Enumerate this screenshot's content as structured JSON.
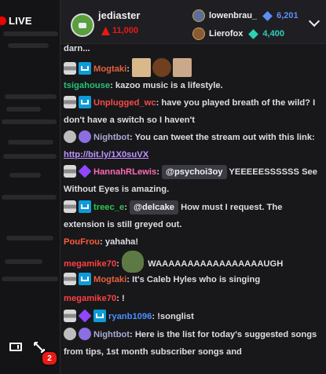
{
  "stream": {
    "live_label": "LIVE",
    "notification_count": "2"
  },
  "header": {
    "host_name": "jediaster",
    "host_bits": "11,000",
    "leaderboard": [
      {
        "name": "lowenbrau_",
        "amount": "6,201",
        "gem_color": "#5d8ef7"
      },
      {
        "name": "Lierofox",
        "amount": "4,400",
        "gem_color": "#2cd1b6"
      }
    ]
  },
  "messages": [
    {
      "badges": [],
      "user": "",
      "text": "darn...",
      "color": "#dedee3"
    },
    {
      "badges": [
        "drum-badge",
        "prime-badge"
      ],
      "user": "Mogtaki",
      "text": "",
      "color": "#e3623b",
      "emotes": 3
    },
    {
      "badges": [],
      "user": "tsigahouse",
      "text": "kazoo music is a lifestyle.",
      "color": "#23c477"
    },
    {
      "badges": [
        "drum-badge",
        "prime-badge"
      ],
      "user": "Unplugged_wc",
      "text": "have you played breath of the wild? I don't have a switch so I haven't",
      "color": "#f84a4a"
    },
    {
      "badges": [
        "bot-badge",
        "verified-badge"
      ],
      "user": "Nightbot",
      "text": "You can tweet the stream out with this link:",
      "link": "http://bit.ly/1X0suVX",
      "color": "#a9a9d4"
    },
    {
      "badges": [
        "drum-badge",
        "gift-badge"
      ],
      "user": "HannahRLewis",
      "mention": "@psychoi3oy",
      "text": "YEEEEESSSSSS See Without Eyes is amazing.",
      "color": "#ff69b4"
    },
    {
      "badges": [
        "drum-badge",
        "prime-badge"
      ],
      "user": "treec_e",
      "mention": "@delcake",
      "text": "How must I request. The extension is still greyed out.",
      "color": "#2ec44f"
    },
    {
      "badges": [],
      "user": "PouFrou",
      "text": "yahaha!",
      "color": "#ff5a3a"
    },
    {
      "badges": [],
      "user": "megamike70",
      "text": "WAAAAAAAAAAAAAAAAAUGH",
      "color": "#ff4040",
      "emotes": 1
    },
    {
      "badges": [
        "drum-badge",
        "prime-badge"
      ],
      "user": "Mogtaki",
      "text": "It's Caleb Hyles who is singing",
      "color": "#e3623b"
    },
    {
      "badges": [],
      "user": "megamike70",
      "text": "!",
      "color": "#ff4040"
    },
    {
      "badges": [
        "drum-badge",
        "gift-badge",
        "prime-badge"
      ],
      "user": "ryanb1096",
      "text": "!songlist",
      "color": "#4a8fff"
    },
    {
      "badges": [
        "bot-badge",
        "verified-badge"
      ],
      "user": "Nightbot",
      "text": "Here is the list for today's suggested songs from tips, 1st month subscriber songs and",
      "color": "#a9a9d4"
    }
  ]
}
